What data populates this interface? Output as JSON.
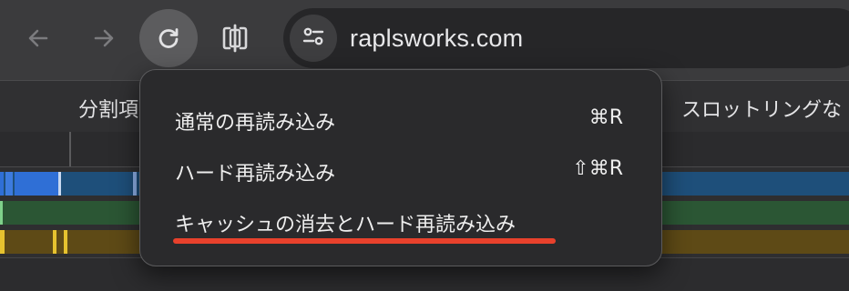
{
  "toolbar": {
    "url": "raplsworks.com"
  },
  "background": {
    "header_left": "分割項",
    "header_right": "スロットリングな"
  },
  "context_menu": {
    "items": [
      {
        "label": "通常の再読み込み",
        "shortcut": "⌘R"
      },
      {
        "label": "ハード再読み込み",
        "shortcut": "⇧⌘R"
      },
      {
        "label": "キャッシュの消去とハード再読み込み",
        "shortcut": ""
      }
    ],
    "highlight_color": "#e8412c"
  },
  "icons": {
    "back": "arrow-left-icon",
    "forward": "arrow-right-icon",
    "reload": "reload-icon",
    "split": "split-view-icon",
    "site_info": "tune-settings-icon"
  }
}
